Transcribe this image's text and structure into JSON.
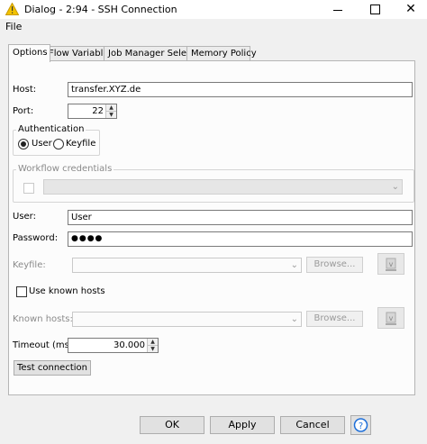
{
  "window": {
    "title": "Dialog - 2:94 - SSH Connection",
    "minimize_glyph": "",
    "maximize_glyph": "",
    "close_glyph": "✕"
  },
  "menu": {
    "file": "File"
  },
  "tabs": [
    {
      "label": "Options",
      "active": true
    },
    {
      "label": "Flow Variables",
      "active": false
    },
    {
      "label": "Job Manager Selection",
      "active": false
    },
    {
      "label": "Memory Policy",
      "active": false
    }
  ],
  "form": {
    "host_label": "Host:",
    "host_value": "transfer.XYZ.de",
    "port_label": "Port:",
    "port_value": "22",
    "auth_group_title": "Authentication",
    "auth_user_label": "User",
    "auth_keyfile_label": "Keyfile",
    "auth_selected": "User",
    "workflow_credentials_title": "Workflow credentials",
    "user_label": "User:",
    "user_value": "User",
    "password_label": "Password:",
    "password_value": "●●●●",
    "keyfile_label": "Keyfile:",
    "keyfile_value": "",
    "keyfile_browse": "Browse...",
    "use_known_hosts_label": "Use known hosts",
    "known_hosts_label": "Known hosts:",
    "known_hosts_value": "",
    "known_hosts_browse": "Browse...",
    "timeout_label": "Timeout (ms):",
    "timeout_value": "30.000",
    "test_connection": "Test connection"
  },
  "footer": {
    "ok": "OK",
    "apply": "Apply",
    "cancel": "Cancel",
    "help_glyph": "?"
  },
  "colors": {
    "accent": "#1e6fd9",
    "warning_icon": "#f2c200"
  },
  "icons": {
    "title": "warning-triangle-icon",
    "help": "help-icon",
    "flow_variable": "flow-variable-icon"
  }
}
